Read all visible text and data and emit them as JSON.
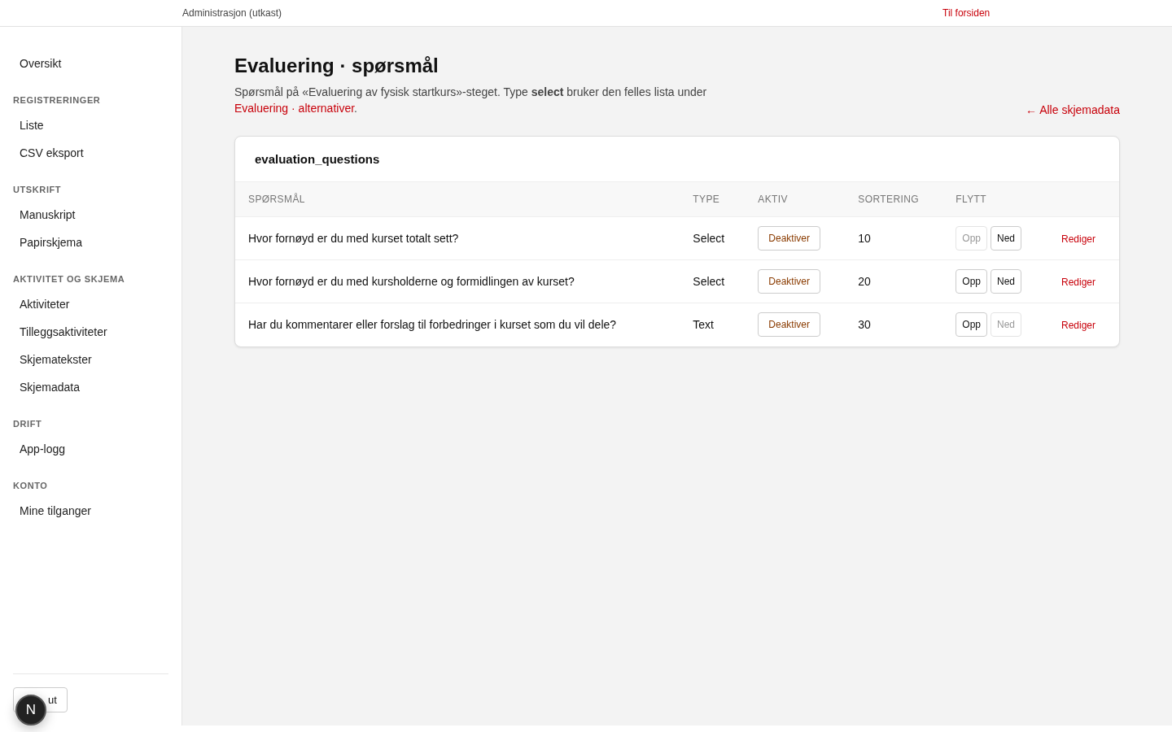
{
  "topbar": {
    "title": "Administrasjon (utkast)",
    "home_link": "Til forsiden"
  },
  "sidebar": {
    "sections": [
      {
        "items": [
          {
            "label": "Oversikt",
            "selected": false
          }
        ]
      },
      {
        "heading": "REGISTRERINGER",
        "items": [
          {
            "label": "Liste",
            "selected": false
          },
          {
            "label": "CSV eksport",
            "selected": false
          }
        ]
      },
      {
        "heading": "UTSKRIFT",
        "items": [
          {
            "label": "Manuskript",
            "selected": false
          },
          {
            "label": "Papirskjema",
            "selected": false
          }
        ]
      },
      {
        "heading": "AKTIVITET OG SKJEMA",
        "items": [
          {
            "label": "Aktiviteter",
            "selected": false
          },
          {
            "label": "Tilleggsaktiviteter",
            "selected": false
          },
          {
            "label": "Skjematekster",
            "selected": false
          },
          {
            "label": "Skjemadata",
            "selected": false
          }
        ]
      },
      {
        "heading": "DRIFT",
        "items": [
          {
            "label": "App-logg",
            "selected": false
          }
        ]
      },
      {
        "heading": "KONTO",
        "items": [
          {
            "label": "Mine tilganger",
            "selected": false
          }
        ]
      }
    ],
    "logout": "ut",
    "badge": "N"
  },
  "page": {
    "title": "Evaluering · spørsmål",
    "description": "Spørsmål på «Evaluering av fysisk startkurs»-steget. Type **select** bruker den felles lista under",
    "description_link": "Evaluering · alternativer",
    "description_end": ".",
    "back_link": "← Alle skjemadata"
  },
  "table": {
    "title": "evaluation_questions",
    "columns": [
      "SPØRSMÅL",
      "TYPE",
      "AKTIV",
      "SORTERING",
      "FLYTT"
    ],
    "rows": [
      {
        "question": "Hvor fornøyd er du med kurset totalt sett?",
        "type": "Select",
        "toggle": "Deaktiver",
        "sort": "10",
        "up": "Opp",
        "up_disabled": true,
        "down": "Ned",
        "down_disabled": false,
        "edit": "Rediger"
      },
      {
        "question": "Hvor fornøyd er du med kursholderne og formidlingen av kurset?",
        "type": "Select",
        "toggle": "Deaktiver",
        "sort": "20",
        "up": "Opp",
        "up_disabled": false,
        "down": "Ned",
        "down_disabled": false,
        "edit": "Rediger"
      },
      {
        "question": "Har du kommentarer eller forslag til forbedringer i kurset som du vil dele?",
        "type": "Text",
        "toggle": "Deaktiver",
        "sort": "30",
        "up": "Opp",
        "up_disabled": false,
        "down": "Ned",
        "down_disabled": true,
        "edit": "Rediger"
      }
    ]
  }
}
